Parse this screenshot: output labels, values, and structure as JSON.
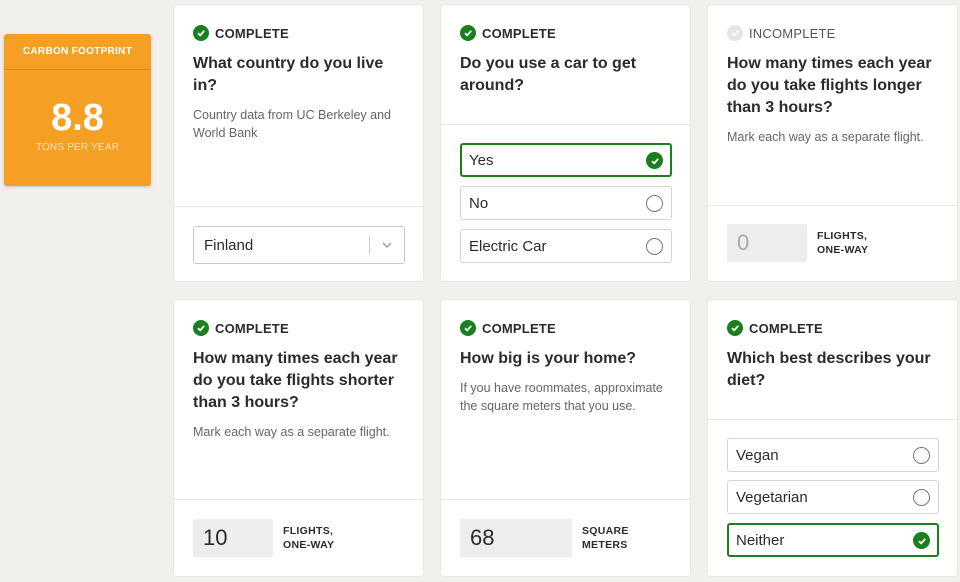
{
  "score": {
    "title": "CARBON FOOTPRINT",
    "value": "8.8",
    "unit": "TONS PER YEAR"
  },
  "colors": {
    "accent_orange": "#f5a023",
    "complete_green": "#1a7f1f",
    "background": "#f1f0ec"
  },
  "cards": {
    "country": {
      "status": "COMPLETE",
      "question": "What country do you live in?",
      "hint": "Country data from UC Berkeley and World Bank",
      "selected": "Finland"
    },
    "car": {
      "status": "COMPLETE",
      "question": "Do you use a car to get around?",
      "options": [
        "Yes",
        "No",
        "Electric Car"
      ],
      "selected": "Yes"
    },
    "long_flights": {
      "status": "INCOMPLETE",
      "question": "How many times each year do you take flights longer than 3 hours?",
      "hint": "Mark each way as a separate flight.",
      "value": "0",
      "unit": "FLIGHTS,\nONE-WAY"
    },
    "short_flights": {
      "status": "COMPLETE",
      "question": "How many times each year do you take flights shorter than 3 hours?",
      "hint": "Mark each way as a separate flight.",
      "value": "10",
      "unit": "FLIGHTS,\nONE-WAY"
    },
    "home": {
      "status": "COMPLETE",
      "question": "How big is your home?",
      "hint": "If you have roommates, approximate the square meters that you use.",
      "value": "68",
      "unit": "SQUARE\nMETERS"
    },
    "diet": {
      "status": "COMPLETE",
      "question": "Which best describes your diet?",
      "options": [
        "Vegan",
        "Vegetarian",
        "Neither"
      ],
      "selected": "Neither"
    }
  }
}
